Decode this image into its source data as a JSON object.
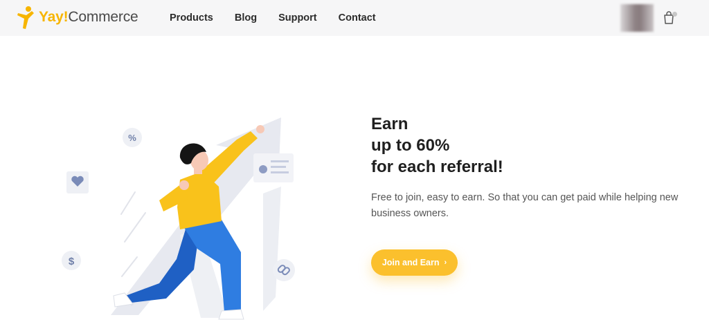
{
  "header": {
    "logo": {
      "part1": "Yay!",
      "part2": "Commerce"
    },
    "nav": [
      {
        "label": "Products"
      },
      {
        "label": "Blog"
      },
      {
        "label": "Support"
      },
      {
        "label": "Contact"
      }
    ],
    "cart_icon": "shopping-bag-icon"
  },
  "hero": {
    "title_lines": [
      "Earn",
      "up to 60%",
      "for each referral!"
    ],
    "description": "Free to join, easy to earn. So that you can get paid while helping new business owners.",
    "cta_label": "Join and Earn",
    "cta_icon": "chevron-right-icon"
  },
  "illustration": {
    "badges": [
      "%",
      "$"
    ],
    "icons": [
      "percent-badge-icon",
      "heart-badge-icon",
      "dollar-badge-icon",
      "link-badge-icon",
      "profile-card-icon",
      "upward-arrow-icon"
    ]
  },
  "colors": {
    "brand_yellow": "#fbc02d",
    "header_bg": "#f6f6f7",
    "pants_blue": "#2f7de1",
    "arrow_gray": "#e7e9f0"
  }
}
